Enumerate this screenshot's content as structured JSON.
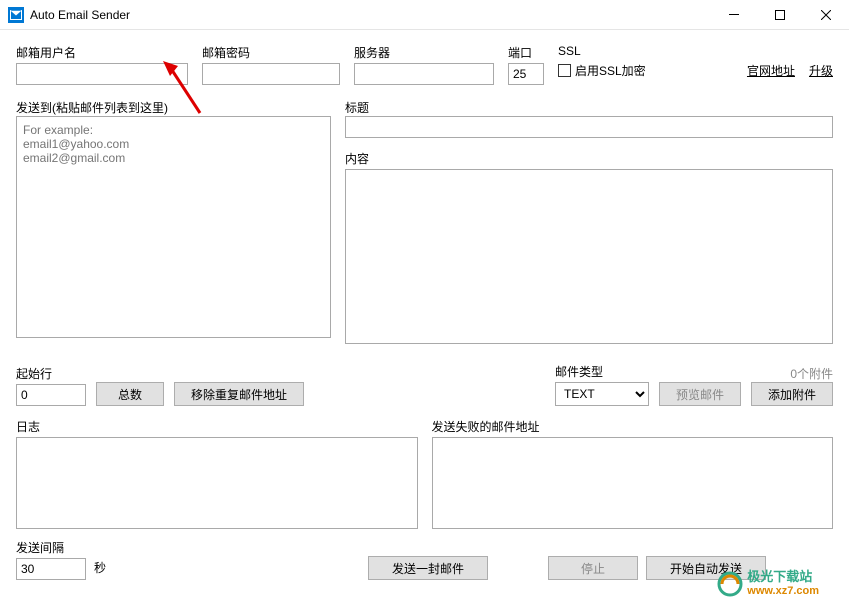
{
  "window": {
    "title": "Auto Email Sender"
  },
  "top": {
    "username_label": "邮箱用户名",
    "username_value": "",
    "password_label": "邮箱密码",
    "password_value": "",
    "server_label": "服务器",
    "server_value": "",
    "port_label": "端口",
    "port_value": "25",
    "ssl_label": "SSL",
    "ssl_checkbox_label": "启用SSL加密",
    "link_official": "官网地址",
    "link_upgrade": "升级"
  },
  "sendto": {
    "label": "发送到(粘贴邮件列表到这里)",
    "placeholder": "For example:\nemail1@yahoo.com\nemail2@gmail.com"
  },
  "subject": {
    "label": "标题",
    "value": ""
  },
  "content": {
    "label": "内容",
    "value": ""
  },
  "startline": {
    "label": "起始行",
    "value": "0",
    "btn_count": "总数",
    "btn_remove_dup": "移除重复邮件地址"
  },
  "mailtype": {
    "label": "邮件类型",
    "value": "TEXT",
    "attachment_count": "0个附件",
    "btn_preview": "预览邮件",
    "btn_attach": "添加附件"
  },
  "log": {
    "label": "日志",
    "value": ""
  },
  "failed": {
    "label": "发送失败的邮件地址",
    "value": ""
  },
  "bottom": {
    "interval_label": "发送间隔",
    "interval_value": "30",
    "interval_unit": "秒",
    "btn_sendone": "发送一封邮件",
    "btn_stop": "停止",
    "btn_start": "开始自动发送"
  },
  "watermark": {
    "line1": "极光下载站",
    "line2": "www.xz7.com"
  }
}
